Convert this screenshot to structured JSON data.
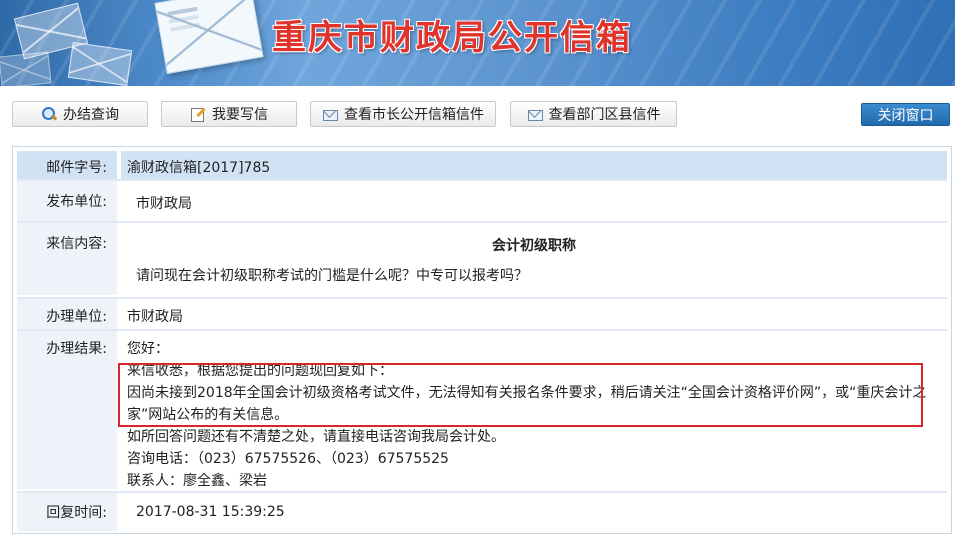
{
  "banner": {
    "title": "重庆市财政局公开信箱"
  },
  "toolbar": {
    "buttons": [
      {
        "label": "办结查询",
        "icon": "search-icon"
      },
      {
        "label": "我要写信",
        "icon": "pencil-icon"
      },
      {
        "label": "查看市长公开信箱信件",
        "icon": "mail-icon"
      },
      {
        "label": "查看部门区县信件",
        "icon": "mail-icon"
      }
    ],
    "close_label": "关闭窗口"
  },
  "letter": {
    "number_label": "邮件字号:",
    "number_value": "渝财政信箱[2017]785",
    "publisher_label": "发布单位:",
    "publisher_value": "市财政局",
    "content_label": "来信内容:",
    "content_title": "会计初级职称",
    "content_body": "请问现在会计初级职称考试的门槛是什么呢？中专可以报考吗？",
    "handler_label": "办理单位:",
    "handler_value": "市财政局",
    "result_label": "办理结果:",
    "result_lines": [
      "您好：",
      "来信收悉，根据您提出的问题现回复如下：",
      "因尚未接到2018年全国会计初级资格考试文件，无法得知有关报名条件要求，稍后请关注“全国会计资格评价网”，或“重庆会计之",
      "家”网站公布的有关信息。",
      "如所回答问题还有不清楚之处，请直接电话咨询我局会计处。",
      "咨询电话：（023）67575526、（023）67575525",
      "联系人：廖全鑫、梁岩"
    ],
    "reply_time_label": "回复时间:",
    "reply_time_value": "2017-08-31 15:39:25"
  }
}
